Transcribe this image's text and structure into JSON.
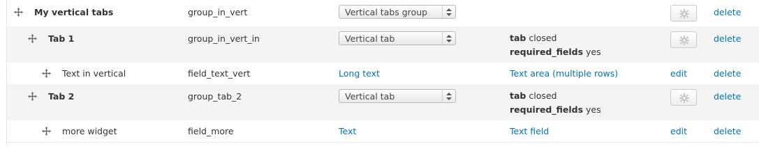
{
  "rows": [
    {
      "label": "My vertical tabs",
      "machine_name": "group_in_vert",
      "widget": "Vertical tabs group",
      "delete_label": "delete"
    },
    {
      "label": "Tab 1",
      "machine_name": "group_in_vert_in",
      "widget": "Vertical tab",
      "summary": [
        {
          "key": "tab",
          "value": "closed"
        },
        {
          "key": "required_fields",
          "value": "yes"
        }
      ],
      "delete_label": "delete"
    },
    {
      "label": "Text in vertical",
      "machine_name": "field_text_vert",
      "field_type": "Long text",
      "widget": "Text area (multiple rows)",
      "edit_label": "edit",
      "delete_label": "delete"
    },
    {
      "label": "Tab 2",
      "machine_name": "group_tab_2",
      "widget": "Vertical tab",
      "summary": [
        {
          "key": "tab",
          "value": "closed"
        },
        {
          "key": "required_fields",
          "value": "yes"
        }
      ],
      "delete_label": "delete"
    },
    {
      "label": "more widget",
      "machine_name": "field_more",
      "field_type": "Text",
      "widget": "Text field",
      "edit_label": "edit",
      "delete_label": "delete"
    }
  ],
  "icons": {
    "drag": "drag-handle-icon",
    "gear": "gear-icon",
    "select_arrows": "select-arrows-icon"
  },
  "colors": {
    "link": "#0074bd",
    "row_alt": "#f4f4f4",
    "border": "#e6e6e6"
  }
}
